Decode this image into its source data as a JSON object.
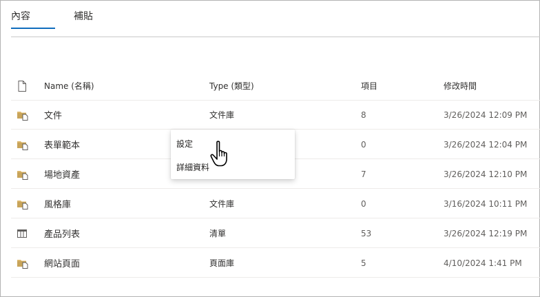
{
  "tabs": [
    {
      "label": "內容",
      "active": true
    },
    {
      "label": "補貼",
      "active": false
    }
  ],
  "columns": {
    "name": "Name (名稱)",
    "type": "Type (類型)",
    "items": "項目",
    "modified": "修改時間"
  },
  "rows": [
    {
      "icon": "document-library-icon",
      "name": "文件",
      "type": "文件庫",
      "items": "8",
      "modified": "3/26/2024 12:09 PM"
    },
    {
      "icon": "document-library-icon",
      "name": "表單範本",
      "type": "",
      "items": "0",
      "modified": "3/26/2024 12:04 PM"
    },
    {
      "icon": "document-library-icon",
      "name": "場地資產",
      "type": "",
      "items": "7",
      "modified": "3/26/2024 12:10 PM"
    },
    {
      "icon": "document-library-icon",
      "name": "風格庫",
      "type": "文件庫",
      "items": "0",
      "modified": "3/16/2024 10:11 PM"
    },
    {
      "icon": "list-icon",
      "name": "產品列表",
      "type": "清單",
      "items": "53",
      "modified": "3/26/2024 12:19 PM"
    },
    {
      "icon": "document-library-icon",
      "name": "網站頁面",
      "type": "頁面庫",
      "items": "5",
      "modified": "4/10/2024 1:41 PM"
    }
  ],
  "context_menu": {
    "items": [
      {
        "label": "設定"
      },
      {
        "label": "詳細資料"
      }
    ]
  },
  "colors": {
    "accent": "#0f6cbd",
    "folder": "#c8a45a",
    "list_icon": "#605e5c"
  }
}
